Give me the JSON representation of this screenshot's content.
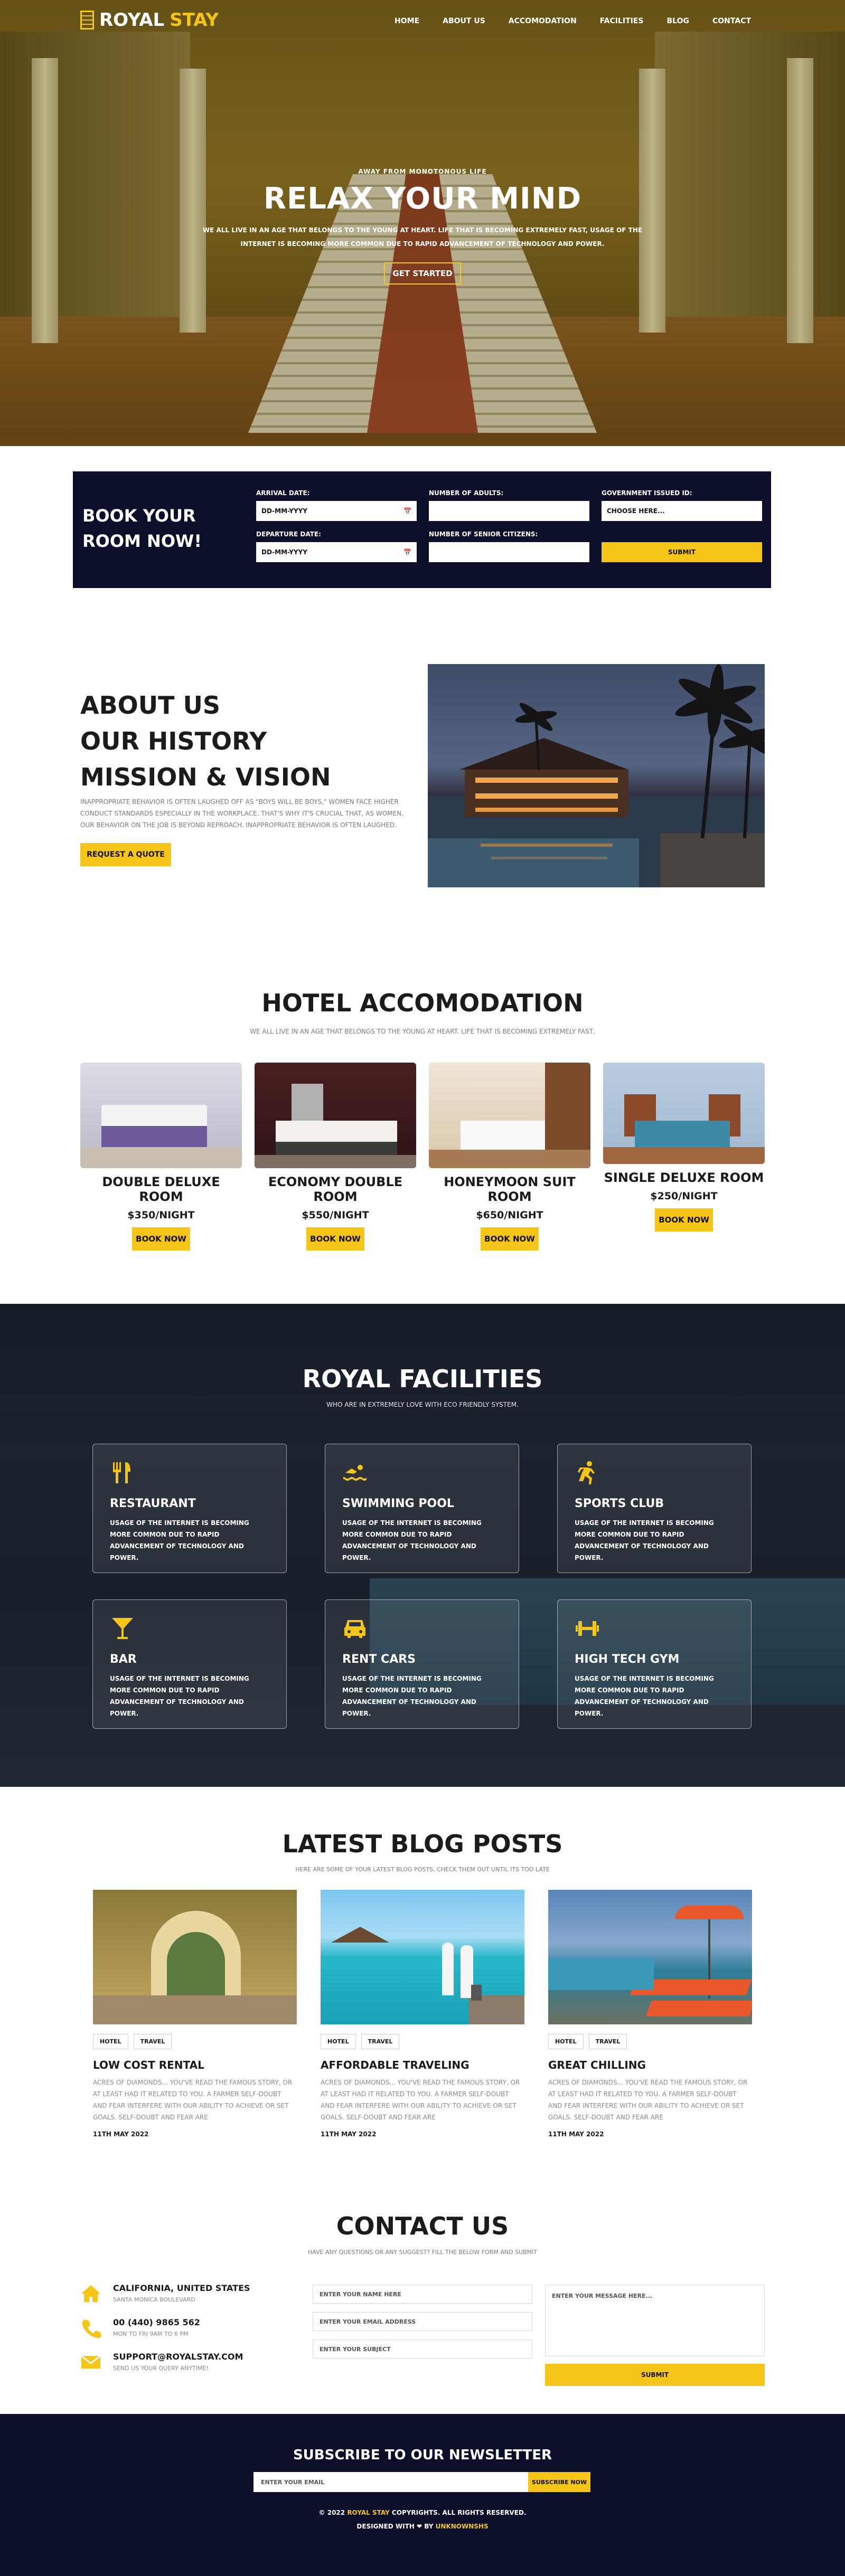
{
  "brand": {
    "name_a": "ROYAL",
    "name_b": "STAY"
  },
  "nav": [
    {
      "label": "HOME"
    },
    {
      "label": "ABOUT US"
    },
    {
      "label": "ACCOMODATION"
    },
    {
      "label": "FACILITIES"
    },
    {
      "label": "BLOG"
    },
    {
      "label": "CONTACT"
    }
  ],
  "hero": {
    "kicker": "AWAY FROM MONOTONOUS LIFE",
    "title": "RELAX YOUR MIND",
    "text": "WE ALL LIVE IN AN AGE THAT BELONGS TO THE YOUNG AT HEART. LIFE THAT IS BECOMING EXTREMELY FAST, USAGE OF THE INTERNET IS BECOMING MORE COMMON DUE TO RAPID ADVANCEMENT OF TECHNOLOGY AND POWER.",
    "cta": "GET STARTED"
  },
  "booking": {
    "title": "BOOK YOUR ROOM NOW!",
    "arrival_label": "ARRIVAL DATE:",
    "arrival_value": "DD-MM-YYYY",
    "departure_label": "DEPARTURE DATE:",
    "departure_value": "DD-MM-YYYY",
    "adults_label": "NUMBER OF ADULTS:",
    "adults_value": "",
    "seniors_label": "NUMBER OF SENIOR CITIZENS:",
    "seniors_value": "",
    "id_label": "GOVERNMENT ISSUED ID:",
    "id_value": "CHOOSE HERE...",
    "submit": "SUBMIT"
  },
  "about": {
    "line1": "ABOUT US",
    "line2": "OUR HISTORY",
    "line3": "MISSION & VISION",
    "text": "INAPPROPRIATE BEHAVIOR IS OFTEN LAUGHED OFF AS \"BOYS WILL BE BOYS,\" WOMEN FACE HIGHER CONDUCT STANDARDS ESPECIALLY IN THE WORKPLACE. THAT'S WHY IT'S CRUCIAL THAT, AS WOMEN, OUR BEHAVIOR ON THE JOB IS BEYOND REPROACH. INAPPROPRIATE BEHAVIOR IS OFTEN LAUGHED.",
    "cta": "REQUEST A QUOTE"
  },
  "accommodation": {
    "title": "HOTEL ACCOMODATION",
    "subtitle": "WE ALL LIVE IN AN AGE THAT BELONGS TO THE YOUNG AT HEART. LIFE THAT IS BECOMING EXTREMELY FAST,",
    "rooms": [
      {
        "name": "DOUBLE DELUXE ROOM",
        "price": "$350/NIGHT",
        "cta": "BOOK NOW"
      },
      {
        "name": "ECONOMY DOUBLE ROOM",
        "price": "$550/NIGHT",
        "cta": "BOOK NOW"
      },
      {
        "name": "HONEYMOON SUIT ROOM",
        "price": "$650/NIGHT",
        "cta": "BOOK NOW"
      },
      {
        "name": "SINGLE DELUXE ROOM",
        "price": "$250/NIGHT",
        "cta": "BOOK NOW"
      }
    ]
  },
  "facilities": {
    "title": "ROYAL FACILITIES",
    "subtitle": "WHO ARE IN EXTREMELY LOVE WITH ECO FRIENDLY SYSTEM.",
    "items": [
      {
        "name": "RESTAURANT",
        "icon": "utensils-icon",
        "text": "USAGE OF THE INTERNET IS BECOMING MORE COMMON DUE TO RAPID ADVANCEMENT OF TECHNOLOGY AND POWER."
      },
      {
        "name": "SWIMMING POOL",
        "icon": "swimmer-icon",
        "text": "USAGE OF THE INTERNET IS BECOMING MORE COMMON DUE TO RAPID ADVANCEMENT OF TECHNOLOGY AND POWER."
      },
      {
        "name": "SPORTS CLUB",
        "icon": "runner-icon",
        "text": "USAGE OF THE INTERNET IS BECOMING MORE COMMON DUE TO RAPID ADVANCEMENT OF TECHNOLOGY AND POWER."
      },
      {
        "name": "BAR",
        "icon": "cocktail-icon",
        "text": "USAGE OF THE INTERNET IS BECOMING MORE COMMON DUE TO RAPID ADVANCEMENT OF TECHNOLOGY AND POWER."
      },
      {
        "name": "RENT CARS",
        "icon": "car-icon",
        "text": "USAGE OF THE INTERNET IS BECOMING MORE COMMON DUE TO RAPID ADVANCEMENT OF TECHNOLOGY AND POWER."
      },
      {
        "name": "HIGH TECH GYM",
        "icon": "dumbbell-icon",
        "text": "USAGE OF THE INTERNET IS BECOMING MORE COMMON DUE TO RAPID ADVANCEMENT OF TECHNOLOGY AND POWER."
      }
    ]
  },
  "blog": {
    "title": "LATEST BLOG POSTS",
    "subtitle": "HERE ARE SOME OF YOUR LATEST BLOG POSTS, CHECK THEM OUT UNTIL ITS TOO LATE",
    "posts": [
      {
        "tag1": "HOTEL",
        "tag2": "TRAVEL",
        "title": "LOW COST RENTAL",
        "text": "ACRES OF DIAMONDS... YOU'VE READ THE FAMOUS STORY, OR AT LEAST HAD IT RELATED TO YOU. A FARMER SELF-DOUBT AND FEAR INTERFERE WITH OUR ABILITY TO ACHIEVE OR SET GOALS. SELF-DOUBT AND FEAR ARE",
        "date": "11TH MAY 2022"
      },
      {
        "tag1": "HOTEL",
        "tag2": "TRAVEL",
        "title": "AFFORDABLE TRAVELING",
        "text": "ACRES OF DIAMONDS... YOU'VE READ THE FAMOUS STORY, OR AT LEAST HAD IT RELATED TO YOU. A FARMER SELF-DOUBT AND FEAR INTERFERE WITH OUR ABILITY TO ACHIEVE OR SET GOALS. SELF-DOUBT AND FEAR ARE",
        "date": "11TH MAY 2022"
      },
      {
        "tag1": "HOTEL",
        "tag2": "TRAVEL",
        "title": "GREAT CHILLING",
        "text": "ACRES OF DIAMONDS... YOU'VE READ THE FAMOUS STORY, OR AT LEAST HAD IT RELATED TO YOU. A FARMER SELF-DOUBT AND FEAR INTERFERE WITH OUR ABILITY TO ACHIEVE OR SET GOALS. SELF-DOUBT AND FEAR ARE",
        "date": "11TH MAY 2022"
      }
    ]
  },
  "contact": {
    "title": "CONTACT US",
    "subtitle": "HAVE ANY QUESTIONS OR ANY SUGGEST? FILL THE BELOW FORM AND SUBMIT",
    "address_main": "CALIFORNIA, UNITED STATES",
    "address_sub": "SANTA MONICA BOULEVARD",
    "phone_main": "00 (440) 9865 562",
    "phone_sub": "MON TO FRI 9AM TO 6 PM",
    "email_main": "SUPPORT@ROYALSTAY.COM",
    "email_sub": "SEND US YOUR QUERY ANYTIME!",
    "name_placeholder": "ENTER YOUR NAME HERE",
    "email_placeholder": "ENTER YOUR EMAIL ADDRESS",
    "subject_placeholder": "ENTER YOUR SUBJECT",
    "message_placeholder": "ENTER YOUR MESSAGE HERE...",
    "submit": "SUBMIT"
  },
  "footer": {
    "newsletter_title": "SUBSCRIBE TO OUR NEWSLETTER",
    "newsletter_placeholder": "ENTER YOUR EMAIL",
    "newsletter_button": "SUBSCRIBE NOW",
    "copy_a": "© 2022",
    "copy_brand": "ROYAL STAY",
    "copy_b": "COPYRIGHTS. ALL RIGHTS RESERVED.",
    "designed_a": "DESIGNED WITH",
    "designed_b": "BY",
    "designed_by": "UNKNOWNSHS"
  },
  "colors": {
    "accent": "#f5c518",
    "navy": "#0b0f29"
  }
}
